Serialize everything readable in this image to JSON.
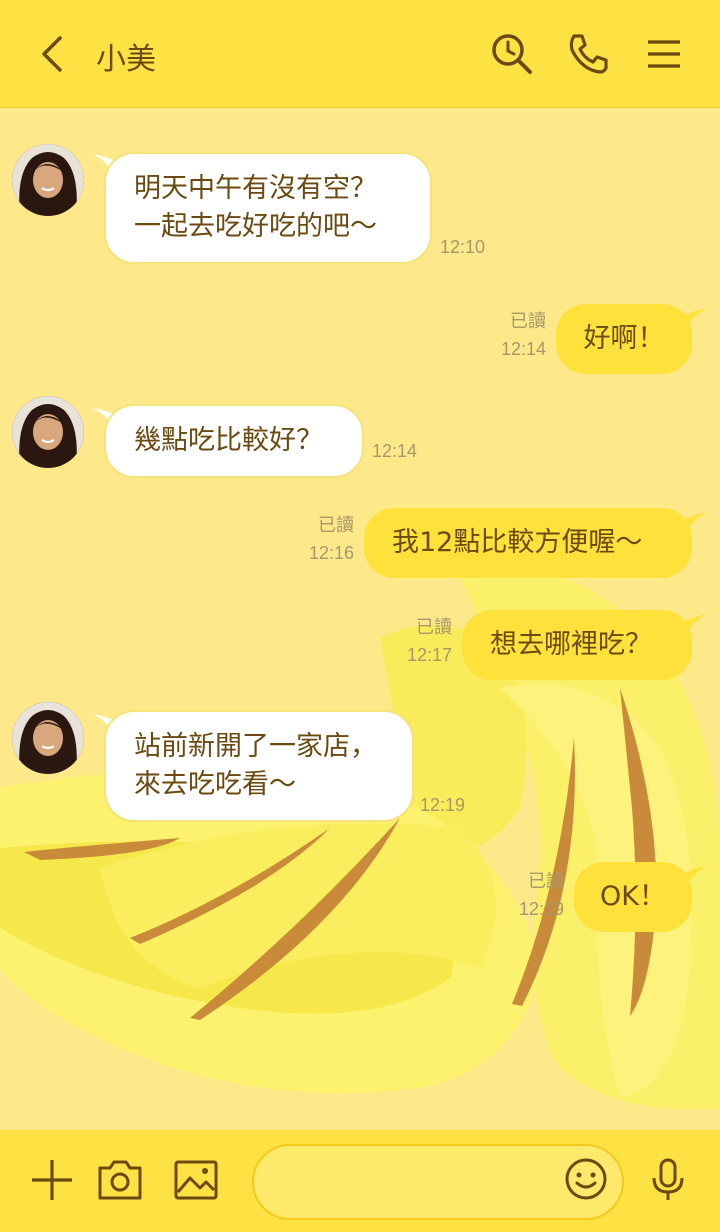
{
  "header": {
    "contact_name": "小美",
    "icons": [
      "back-chevron-icon",
      "search-icon",
      "phone-icon",
      "menu-icon"
    ]
  },
  "messages": [
    {
      "direction": "incoming",
      "text": "明天中午有沒有空？\n一起去吃好吃的吧～",
      "time": "12:10"
    },
    {
      "direction": "outgoing",
      "text": "好啊！",
      "read": "已讀",
      "time": "12:14"
    },
    {
      "direction": "incoming",
      "text": "幾點吃比較好？",
      "time": "12:14"
    },
    {
      "direction": "outgoing",
      "text": "我12點比較方便喔～",
      "read": "已讀",
      "time": "12:16"
    },
    {
      "direction": "outgoing",
      "text": "想去哪裡吃？",
      "read": "已讀",
      "time": "12:17"
    },
    {
      "direction": "incoming",
      "text": "站前新開了一家店，\n來去吃吃看～",
      "time": "12:19"
    },
    {
      "direction": "outgoing",
      "text": "OK！",
      "read": "已讀",
      "time": "12:19"
    }
  ],
  "footer": {
    "icons": [
      "plus-icon",
      "camera-icon",
      "image-icon",
      "emoji-icon",
      "microphone-icon"
    ],
    "input_placeholder": ""
  },
  "colors": {
    "header_bg": "#fee142",
    "chat_bg": "#fde98a",
    "outgoing_bubble": "#ffe13c",
    "incoming_bubble": "#ffffff",
    "text": "#6b4a12",
    "meta_text": "#a8976a"
  }
}
